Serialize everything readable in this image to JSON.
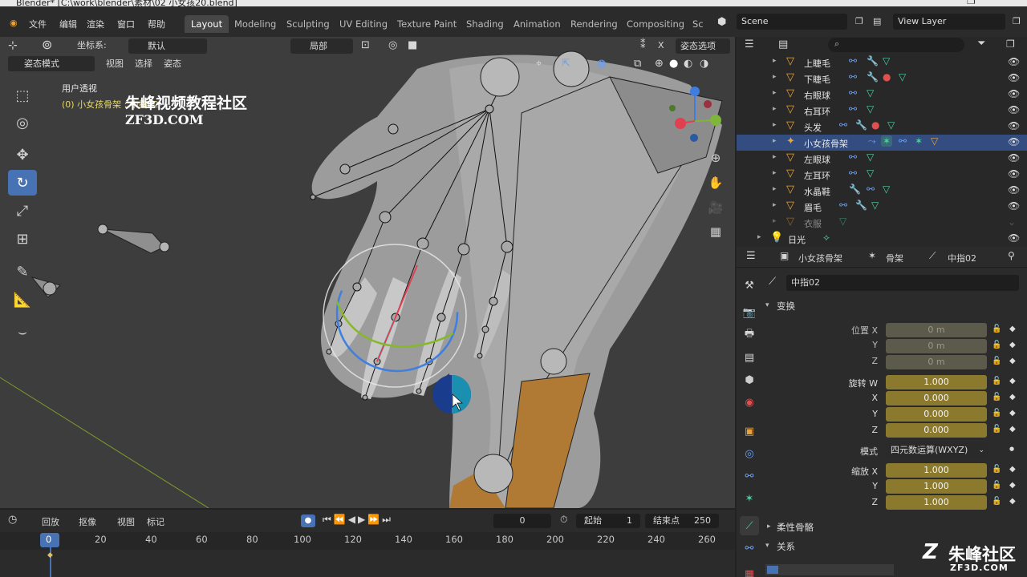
{
  "window": {
    "title": "Blender* [C:\\work\\blender\\素材\\02 小女孩20.blend]"
  },
  "menu": {
    "items": [
      "文件",
      "编辑",
      "渲染",
      "窗口",
      "帮助"
    ]
  },
  "workspaces": [
    "Layout",
    "Modeling",
    "Sculpting",
    "UV Editing",
    "Texture Paint",
    "Shading",
    "Animation",
    "Rendering",
    "Compositing",
    "Sc"
  ],
  "scene": {
    "name": "Scene",
    "view_layer": "View Layer"
  },
  "viewport": {
    "coord_label": "坐标系:",
    "coord_value": "默认",
    "pivot_value": "局部",
    "pose_options": "姿态选项",
    "mode": "姿态模式",
    "menus": [
      "视图",
      "选择",
      "姿态"
    ],
    "overlay_title": "用户透视",
    "overlay_sub": "(0) 小女孩骨架 : 中指02",
    "watermark_cn": "朱峰视频教程社区",
    "watermark_en": "ZF3D.COM"
  },
  "outliner": {
    "search_placeholder": "",
    "rows": [
      {
        "label": "上睫毛"
      },
      {
        "label": "下睫毛"
      },
      {
        "label": "右眼球"
      },
      {
        "label": "右耳环"
      },
      {
        "label": "头发"
      },
      {
        "label": "小女孩骨架",
        "selected": true
      },
      {
        "label": "左眼球"
      },
      {
        "label": "左耳环"
      },
      {
        "label": "水晶鞋"
      },
      {
        "label": "眉毛"
      },
      {
        "label": "衣服"
      },
      {
        "label": "日光"
      }
    ]
  },
  "properties": {
    "breadcrumb": [
      "小女孩骨架",
      "骨架",
      "中指02"
    ],
    "bone_name": "中指02",
    "transform_section": "变换",
    "location_label": "位置 X",
    "location": [
      "0 m",
      "0 m",
      "0 m"
    ],
    "rotation_label": "旋转 W",
    "rotation": [
      "1.000",
      "0.000",
      "0.000",
      "0.000"
    ],
    "mode_label": "模式",
    "mode_value": "四元数运算(WXYZ)",
    "scale_label": "缩放 X",
    "scale": [
      "1.000",
      "1.000",
      "1.000"
    ],
    "axis_y": "Y",
    "axis_z": "Z",
    "axis_x": "X",
    "section_bendy": "柔性骨骼",
    "section_relations": "关系"
  },
  "timeline": {
    "playback": "回放",
    "keying": "抠像",
    "view": "视图",
    "marker": "标记",
    "current_frame": "0",
    "start_label": "起始",
    "start": "1",
    "end_label": "结束点",
    "end": "250",
    "ruler": [
      "0",
      "20",
      "40",
      "60",
      "80",
      "100",
      "120",
      "140",
      "160",
      "180",
      "200",
      "220",
      "240",
      "260"
    ]
  },
  "brand": {
    "cn": "朱峰社区",
    "en": "ZF3D.COM"
  },
  "colors": {
    "accent": "#4772b3",
    "selected_row": "#334d80",
    "field_yellow": "#8b7a2e",
    "bone_orange": "#e8a33d"
  }
}
